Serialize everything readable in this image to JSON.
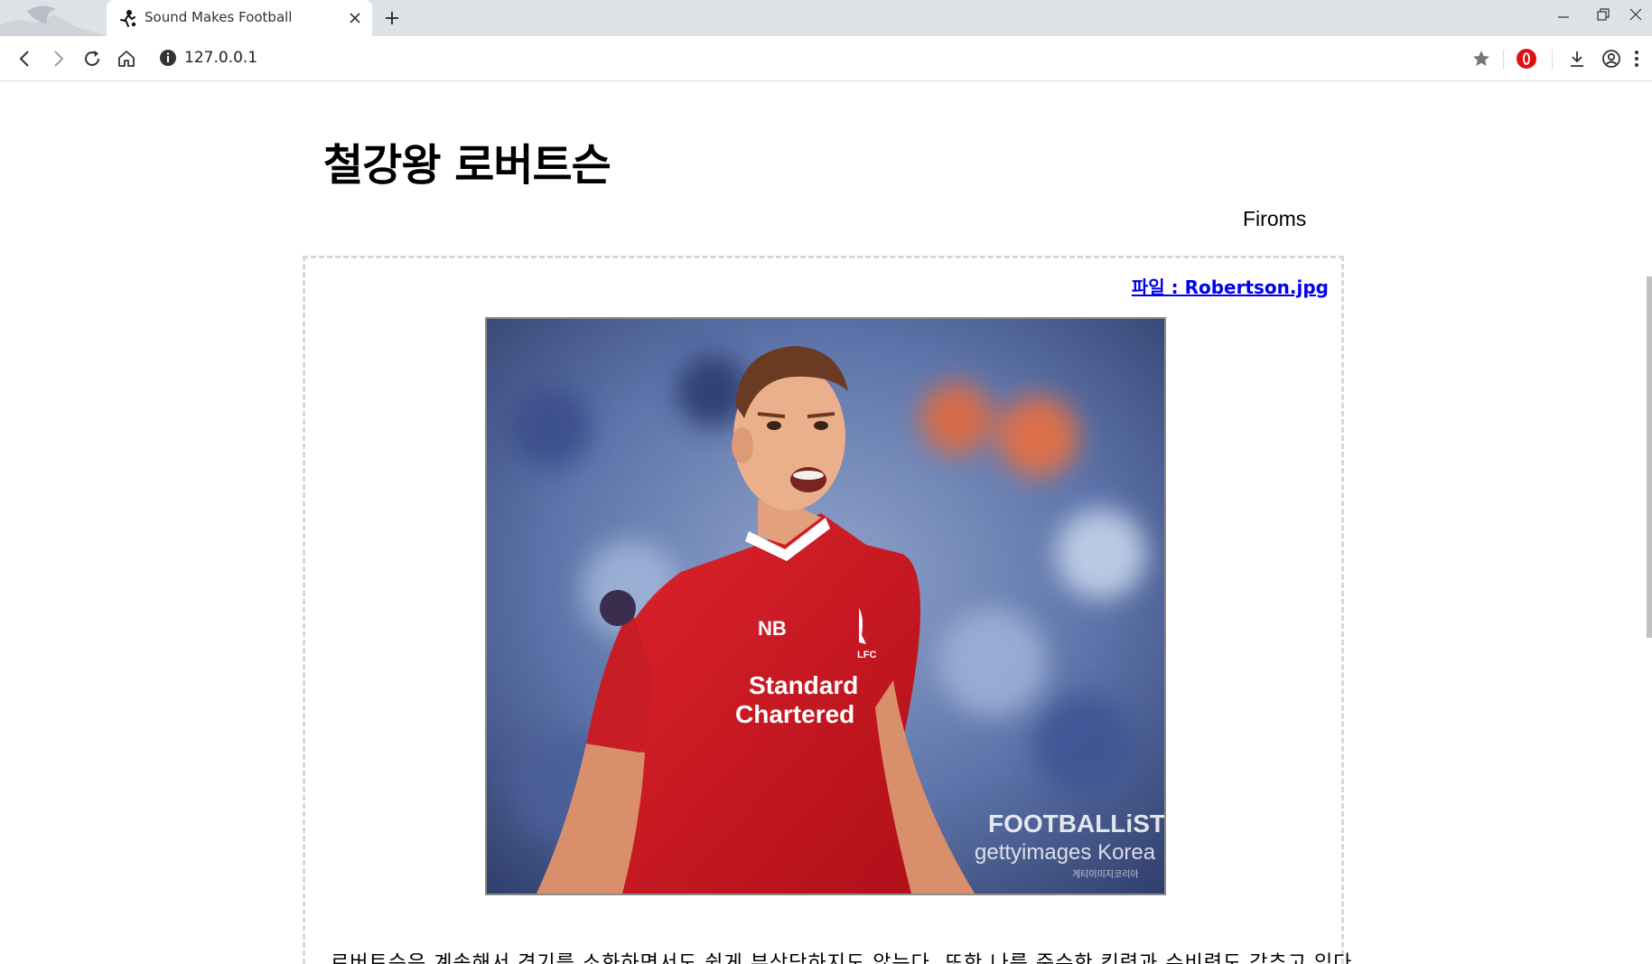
{
  "browser": {
    "tab_title": "Sound Makes Football",
    "url": "127.0.0.1"
  },
  "page": {
    "title": "철강왕 로버트슨",
    "author": "Firoms",
    "file_link": "파일 : Robertson.jpg",
    "body_text": "로버트슨은 계속해서 경기를 소화하면서도 쉽게 부상당하지도 않는다. 또한 나름 준수한 킥력과 수비력도 갖추고 있다."
  },
  "photo": {
    "watermark_brand": "FOOTBALLiST",
    "watermark_getty": "gettyimages Korea",
    "watermark_small": "게티이미지코리아",
    "shirt_sponsor_line1": "Standard",
    "shirt_sponsor_line2": "Chartered",
    "crest_text": "LFC"
  },
  "icons": {
    "back": "arrow-left-icon",
    "forward": "arrow-right-icon",
    "reload": "reload-icon",
    "home": "home-icon",
    "info": "info-icon",
    "bookmark": "star-icon",
    "extension": "opera-icon",
    "download": "download-icon",
    "account": "account-icon",
    "menu": "kebab-menu-icon"
  }
}
